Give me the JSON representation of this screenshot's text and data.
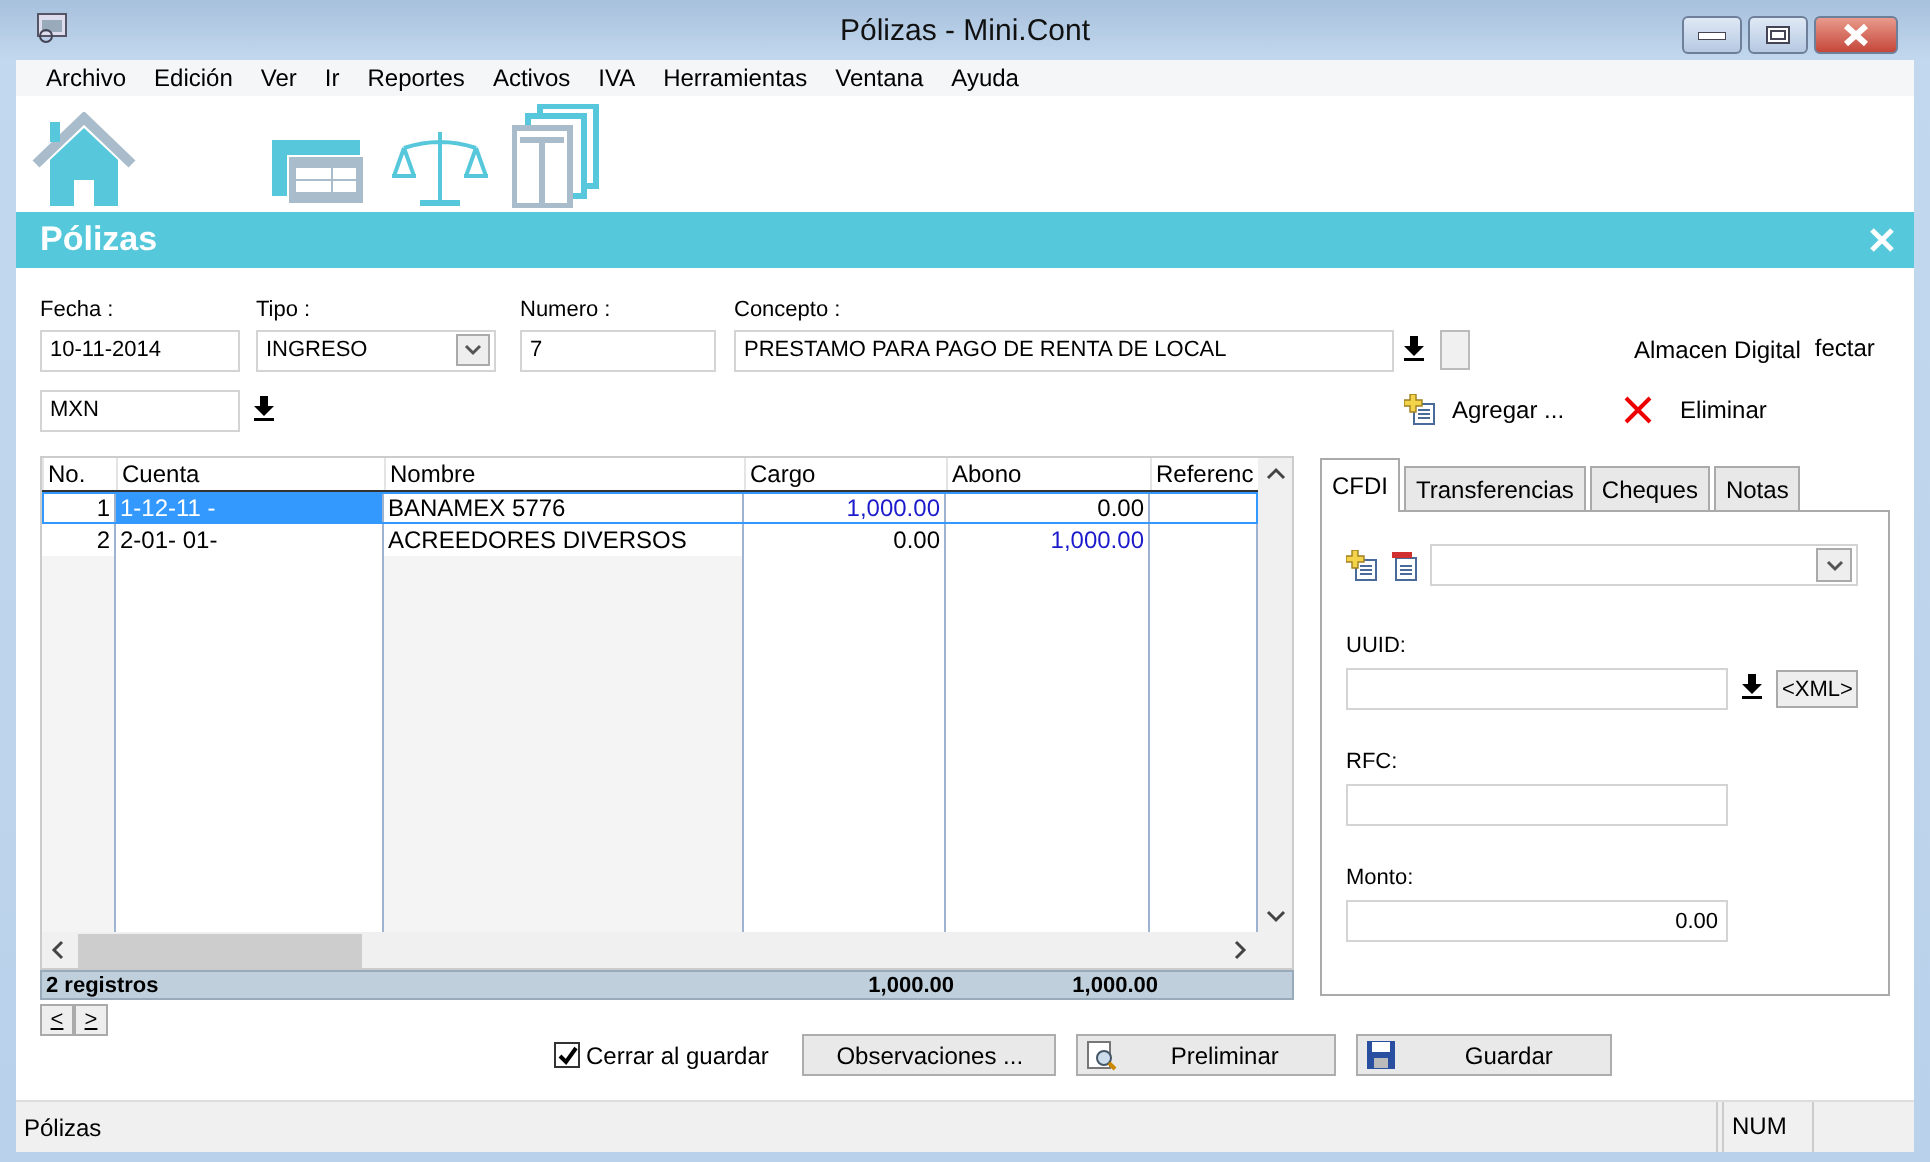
{
  "window": {
    "title": "Pólizas - Mini.Cont"
  },
  "menu": [
    "Archivo",
    "Edición",
    "Ver",
    "Ir",
    "Reportes",
    "Activos",
    "IVA",
    "Herramientas",
    "Ventana",
    "Ayuda"
  ],
  "header": {
    "title": "Pólizas"
  },
  "form": {
    "fields": [
      {
        "label": "Fecha :",
        "value": "10-11-2014",
        "kind": "text"
      },
      {
        "label": "Tipo :",
        "value": "INGRESO",
        "kind": "combo"
      },
      {
        "label": "Numero :",
        "value": "7",
        "kind": "text"
      },
      {
        "label": "Concepto :",
        "value": "PRESTAMO PARA PAGO DE RENTA DE LOCAL",
        "kind": "lookup"
      }
    ],
    "currency": "MXN",
    "almacen": "Almacen Digital",
    "conectar": "fectar",
    "agregar": "Agregar ...",
    "eliminar": "Eliminar"
  },
  "table": {
    "columns": [
      "No.",
      "Cuenta",
      "Nombre",
      "Cargo",
      "Abono",
      "Referenc"
    ],
    "rows": [
      {
        "cells": [
          "1",
          "1-12-11 -",
          "BANAMEX 5776",
          "1,000.00",
          "0.00",
          ""
        ],
        "cargo_emphasis": true,
        "abono_emphasis": false,
        "selected": true
      },
      {
        "cells": [
          "2",
          "2-01- 01-",
          "ACREEDORES DIVERSOS",
          "0.00",
          "1,000.00",
          ""
        ],
        "cargo_emphasis": false,
        "abono_emphasis": true,
        "selected": false
      }
    ],
    "footer": {
      "count": "2 registros",
      "cargo": "1,000.00",
      "abono": "1,000.00"
    }
  },
  "pager": [
    "<",
    ">"
  ],
  "tabs": [
    {
      "label": "CFDI",
      "selected": true
    },
    {
      "label": "Transferencias",
      "selected": false
    },
    {
      "label": "Cheques",
      "selected": false
    },
    {
      "label": "Notas",
      "selected": false
    }
  ],
  "cfdi": {
    "uuid_label": "UUID:",
    "xml_button": "<XML>",
    "rfc_label": "RFC:",
    "monto_label": "Monto:",
    "monto": "0.00"
  },
  "actions": {
    "close_on_save": {
      "label": "Cerrar al guardar",
      "checked": true
    },
    "buttons": [
      "Observaciones ...",
      "Preliminar",
      "Guardar"
    ]
  },
  "status_bar": {
    "left": "Pólizas",
    "right": "NUM"
  }
}
